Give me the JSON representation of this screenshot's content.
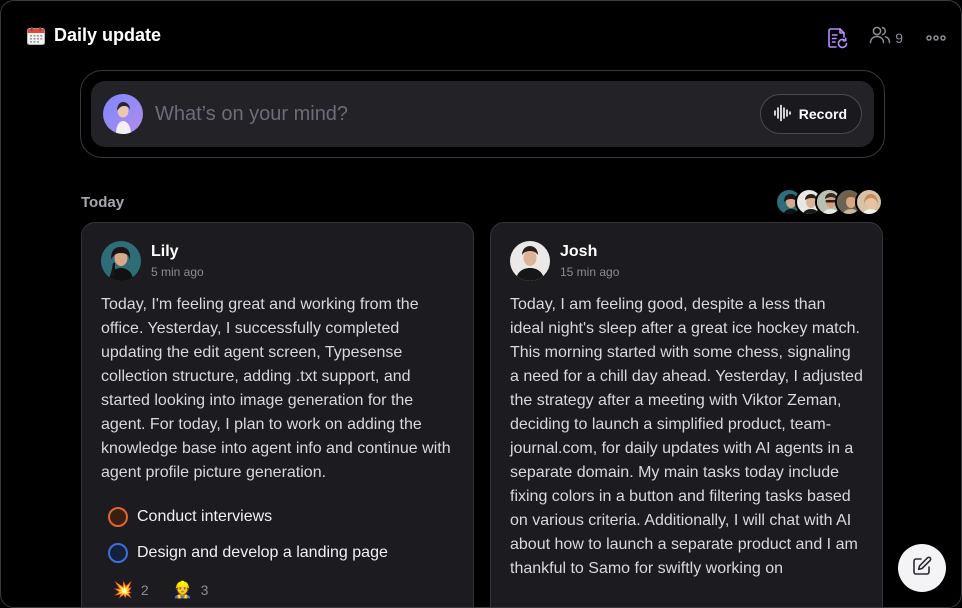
{
  "header": {
    "title": "Daily update",
    "calendar_icon": "calendar-icon",
    "journal_icon": "journal-refresh-icon",
    "members_icon": "users-icon",
    "members_count": "9",
    "more_icon": "more-horizontal-icon",
    "accent_color": "#b98cff"
  },
  "composer": {
    "placeholder": "What’s on your mind?",
    "record_label": "Record",
    "record_icon": "waveform-icon"
  },
  "feed": {
    "section_label": "Today",
    "posts": [
      {
        "name": "Lily",
        "time": "5 min ago",
        "body": "Today, I'm feeling great and working from the office. Yesterday, I successfully completed updating the edit agent screen, Typesense collection structure, adding .txt support, and started looking into image generation for the agent. For today, I plan to work on adding the knowledge base into agent info and continue with agent profile picture generation.",
        "tasks": [
          {
            "label": "Conduct interviews",
            "color": "#e0662c"
          },
          {
            "label": "Design and develop a landing page",
            "color": "#3b6fe0"
          }
        ],
        "reactions": [
          {
            "emoji": "💥",
            "count": "2"
          },
          {
            "emoji": "👷",
            "count": "3"
          }
        ]
      },
      {
        "name": "Josh",
        "time": "15 min ago",
        "body": "Today, I am feeling good, despite a less than ideal night's sleep after a great ice hockey match. This morning started with some chess, signaling a need for a chill day ahead. Yesterday, I adjusted the strategy after a meeting with Viktor Zeman, deciding to launch a simplified product, team-journal.com, for daily updates with AI agents in a separate domain. My main tasks today include fixing colors in a button and filtering tasks based on various criteria. Additionally, I will chat with AI about how to launch a separate product and I am thankful to Samo for swiftly working on"
      }
    ]
  },
  "fab": {
    "icon": "edit-icon"
  }
}
